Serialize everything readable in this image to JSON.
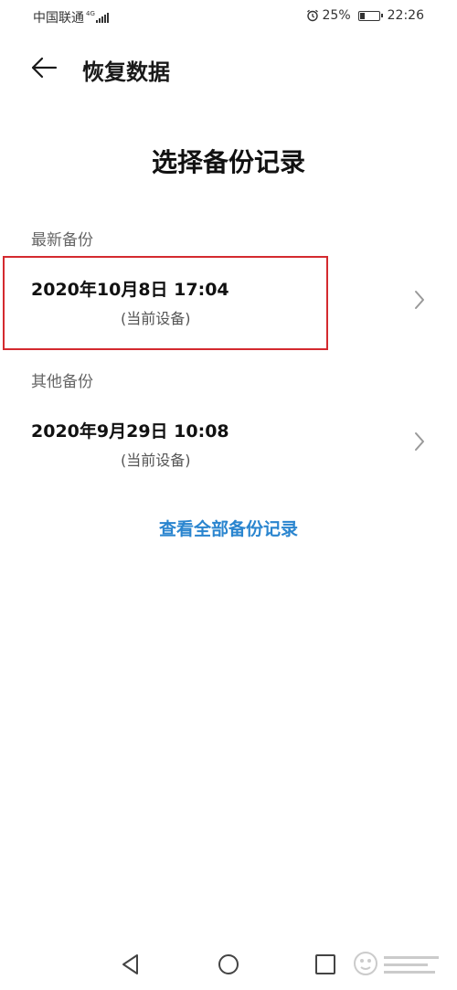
{
  "status_bar": {
    "carrier": "中国联通",
    "network_type": "4G",
    "battery_percent": "25%",
    "battery_level": 0.25,
    "time": "22:26"
  },
  "header": {
    "title": "恢复数据"
  },
  "page": {
    "section_title": "选择备份记录"
  },
  "latest": {
    "group_label": "最新备份",
    "date": "2020年10月8日 17:04",
    "device": "(当前设备)"
  },
  "others": {
    "group_label": "其他备份",
    "date": "2020年9月29日 10:08",
    "device": "(当前设备)"
  },
  "actions": {
    "view_all": "查看全部备份记录"
  },
  "colors": {
    "link": "#2a85cf",
    "highlight": "#d42a2f"
  },
  "icons": [
    "back-arrow-icon",
    "chevron-right-icon",
    "alarm-icon",
    "battery-icon",
    "signal-icon",
    "nav-back-icon",
    "nav-home-icon",
    "nav-recents-icon"
  ]
}
